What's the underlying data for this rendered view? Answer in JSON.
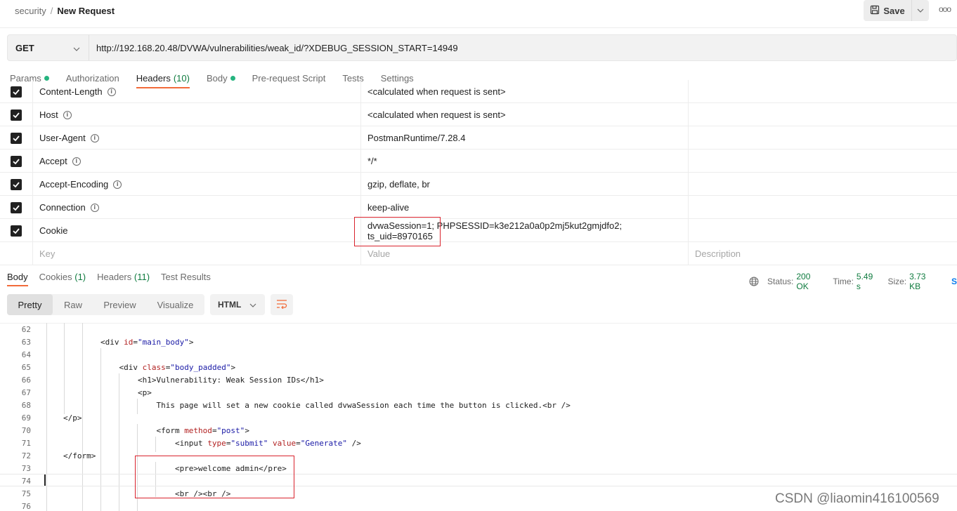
{
  "breadcrumb": {
    "parent": "security",
    "separator": "/",
    "current": "New Request"
  },
  "toolbar": {
    "save_label": "Save",
    "save_icon": "save-disk-icon",
    "more_label": "ooo"
  },
  "request": {
    "method": "GET",
    "url": "http://192.168.20.48/DVWA/vulnerabilities/weak_id/?XDEBUG_SESSION_START=14949"
  },
  "request_tabs": [
    {
      "label": "Params",
      "dot": true
    },
    {
      "label": "Authorization"
    },
    {
      "label": "Headers",
      "count": "(10)",
      "active": true
    },
    {
      "label": "Body",
      "dot": true
    },
    {
      "label": "Pre-request Script"
    },
    {
      "label": "Tests"
    },
    {
      "label": "Settings"
    }
  ],
  "headers": [
    {
      "checked": true,
      "key": "Content-Length",
      "info": true,
      "value": "<calculated when request is sent>"
    },
    {
      "checked": true,
      "key": "Host",
      "info": true,
      "value": "<calculated when request is sent>"
    },
    {
      "checked": true,
      "key": "User-Agent",
      "info": true,
      "value": "PostmanRuntime/7.28.4"
    },
    {
      "checked": true,
      "key": "Accept",
      "info": true,
      "value": "*/*"
    },
    {
      "checked": true,
      "key": "Accept-Encoding",
      "info": true,
      "value": "gzip, deflate, br"
    },
    {
      "checked": true,
      "key": "Connection",
      "info": true,
      "value": "keep-alive"
    },
    {
      "checked": true,
      "key": "Cookie",
      "info": false,
      "value": "dvwaSession=1; PHPSESSID=k3e212a0a0p2mj5kut2gmjdfo2; ts_uid=8970165"
    }
  ],
  "headers_placeholder": {
    "key": "Key",
    "value": "Value",
    "description": "Description"
  },
  "response_tabs": [
    {
      "label": "Body",
      "active": true
    },
    {
      "label": "Cookies",
      "count": "(1)"
    },
    {
      "label": "Headers",
      "count": "(11)"
    },
    {
      "label": "Test Results"
    }
  ],
  "response_meta": {
    "status_label": "Status:",
    "status": "200 OK",
    "time_label": "Time:",
    "time": "5.49 s",
    "size_label": "Size:",
    "size": "3.73 KB",
    "trailing": "S"
  },
  "view_modes": [
    "Pretty",
    "Raw",
    "Preview",
    "Visualize"
  ],
  "active_view": "Pretty",
  "format": "HTML",
  "code_lines": [
    {
      "n": "62",
      "html": ""
    },
    {
      "n": "63",
      "html": "        &lt;div <span class=\"attr\">id</span>=<span class=\"str\">\"main_body\"</span>&gt;"
    },
    {
      "n": "64",
      "html": ""
    },
    {
      "n": "65",
      "html": "            &lt;div <span class=\"attr\">class</span>=<span class=\"str\">\"body_padded\"</span>&gt;"
    },
    {
      "n": "66",
      "html": "                &lt;h1&gt;Vulnerability: Weak Session IDs&lt;/h1&gt;"
    },
    {
      "n": "67",
      "html": "                &lt;p&gt;"
    },
    {
      "n": "68",
      "html": "                    This page will set a new cookie called dvwaSession each time the button is clicked.&lt;br /&gt;"
    },
    {
      "n": "69",
      "html": "&lt;/p&gt;"
    },
    {
      "n": "70",
      "html": "                    &lt;form <span class=\"attr\">method</span>=<span class=\"str\">\"post\"</span>&gt;"
    },
    {
      "n": "71",
      "html": "                        &lt;input <span class=\"attr\">type</span>=<span class=\"str\">\"submit\"</span> <span class=\"attr\">value</span>=<span class=\"str\">\"Generate\"</span> /&gt;"
    },
    {
      "n": "72",
      "html": "&lt;/form&gt;"
    },
    {
      "n": "73",
      "html": "                        &lt;pre&gt;welcome admin&lt;/pre&gt;"
    },
    {
      "n": "74",
      "html": ""
    },
    {
      "n": "75",
      "html": "                        &lt;br /&gt;&lt;br /&gt;"
    },
    {
      "n": "76",
      "html": ""
    }
  ],
  "watermark": "CSDN @liaomin416100569",
  "colors": {
    "accent": "#f26b3a",
    "success": "#0f7b3f",
    "dot": "#26b47f",
    "highlight_box": "#d9232d"
  }
}
